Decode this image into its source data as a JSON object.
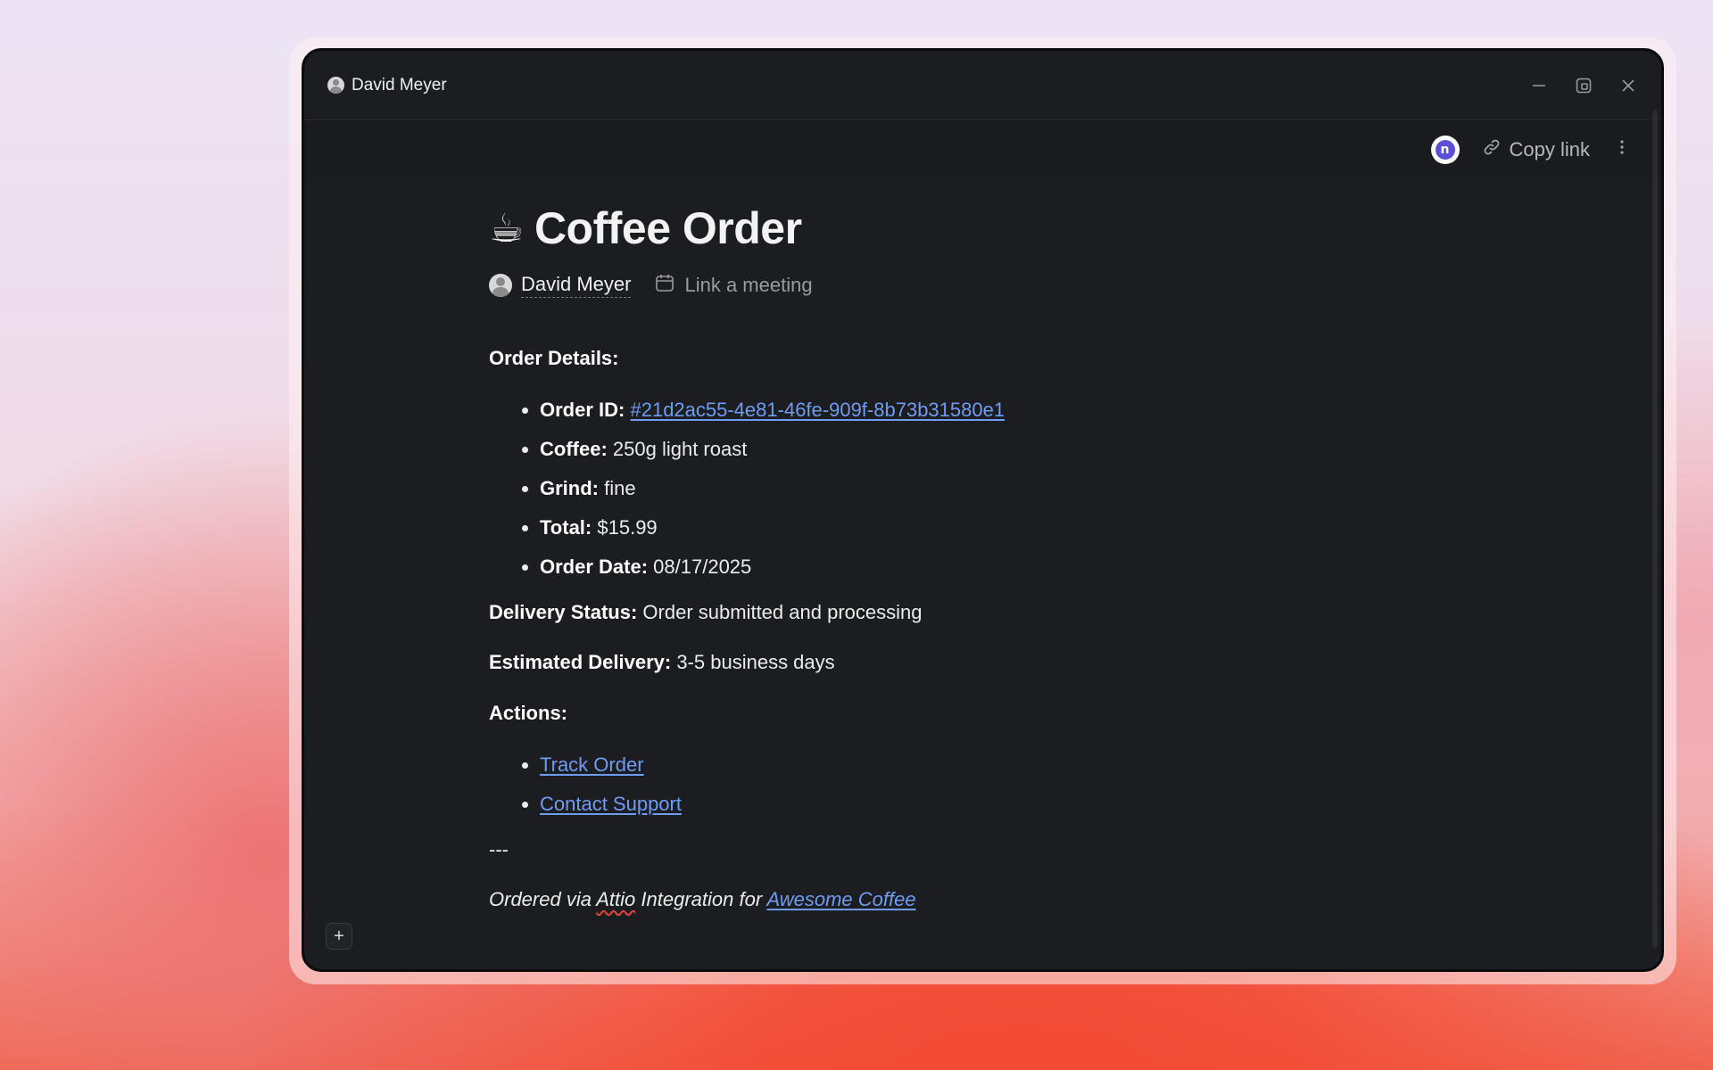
{
  "window": {
    "titlebar_user": "David Meyer",
    "controls": [
      "minimize-icon",
      "restore-icon",
      "close-icon"
    ]
  },
  "toolbar": {
    "app_badge_letter": "n",
    "copy_link_label": "Copy link",
    "more_icon": "vertical-ellipsis-icon"
  },
  "note": {
    "emoji": "☕",
    "title": "Coffee Order",
    "author": "David Meyer",
    "link_meeting": "Link a meeting"
  },
  "body": {
    "order_details_heading": "Order Details:",
    "items": [
      {
        "label": "Order ID:",
        "value": "#21d2ac55-4e81-46fe-909f-8b73b31580e1",
        "is_link": true
      },
      {
        "label": "Coffee:",
        "value": "250g light roast"
      },
      {
        "label": "Grind:",
        "value": "fine"
      },
      {
        "label": "Total:",
        "value": "$15.99"
      },
      {
        "label": "Order Date:",
        "value": "08/17/2025"
      }
    ],
    "delivery_status_label": "Delivery Status:",
    "delivery_status_value": "Order submitted and processing",
    "estimated_delivery_label": "Estimated Delivery:",
    "estimated_delivery_value": "3-5 business days",
    "actions_heading": "Actions:",
    "actions": [
      "Track Order",
      "Contact Support"
    ],
    "separator": "---",
    "footer_prefix": "Ordered via ",
    "footer_brand": "Attio",
    "footer_middle": " Integration for ",
    "footer_link": "Awesome Coffee"
  },
  "colors": {
    "window_bg": "#1c1d20",
    "link": "#6f9cf2",
    "app_badge": "#5a4fd6"
  }
}
